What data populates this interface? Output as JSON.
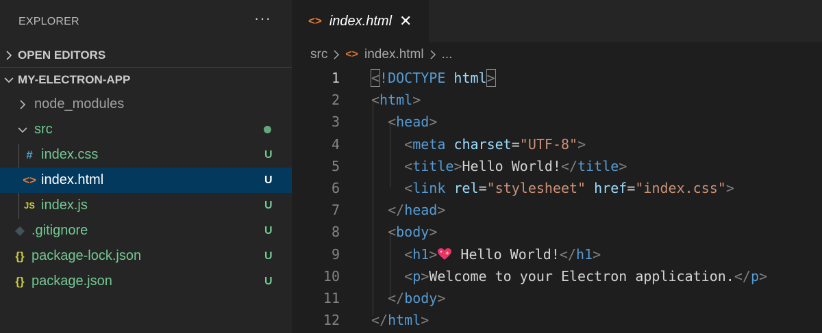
{
  "sidebar": {
    "title": "EXPLORER",
    "more_label": "···",
    "open_editors": "OPEN EDITORS",
    "project": "MY-ELECTRON-APP",
    "items": [
      {
        "label": "node_modules",
        "icon": "chevron-right-icon",
        "badge": ""
      },
      {
        "label": "src",
        "icon": "chevron-down-icon",
        "badge": ""
      },
      {
        "label": "index.css",
        "icon": "#",
        "badge": "U"
      },
      {
        "label": "index.html",
        "icon": "<>",
        "badge": "U"
      },
      {
        "label": "index.js",
        "icon": "JS",
        "badge": "U"
      },
      {
        "label": ".gitignore",
        "icon": "diamond-icon",
        "badge": "U"
      },
      {
        "label": "package-lock.json",
        "icon": "{}",
        "badge": "U"
      },
      {
        "label": "package.json",
        "icon": "{}",
        "badge": "U"
      }
    ]
  },
  "editor": {
    "tab": {
      "label": "index.html",
      "icon": "<>",
      "close": "✕"
    },
    "breadcrumb": {
      "folder": "src",
      "file": "index.html",
      "symbol": "..."
    },
    "line_numbers": [
      "1",
      "2",
      "3",
      "4",
      "5",
      "6",
      "7",
      "8",
      "9",
      "10",
      "11",
      "12"
    ],
    "code": {
      "doctype": "!DOCTYPE",
      "html": "html",
      "head": "head",
      "meta": "meta",
      "charset_attr": "charset",
      "charset_val": "\"UTF-8\"",
      "title": "title",
      "title_text": "Hello World!",
      "link": "link",
      "rel_attr": "rel",
      "rel_val": "\"stylesheet\"",
      "href_attr": "href",
      "href_val": "\"index.css\"",
      "body": "body",
      "h1": "h1",
      "h1_text": " Hello World!",
      "p": "p",
      "p_text": "Welcome to your Electron application."
    }
  },
  "colors": {
    "untracked": "#73c991",
    "html_icon": "#e37933",
    "selection": "#04395e"
  }
}
